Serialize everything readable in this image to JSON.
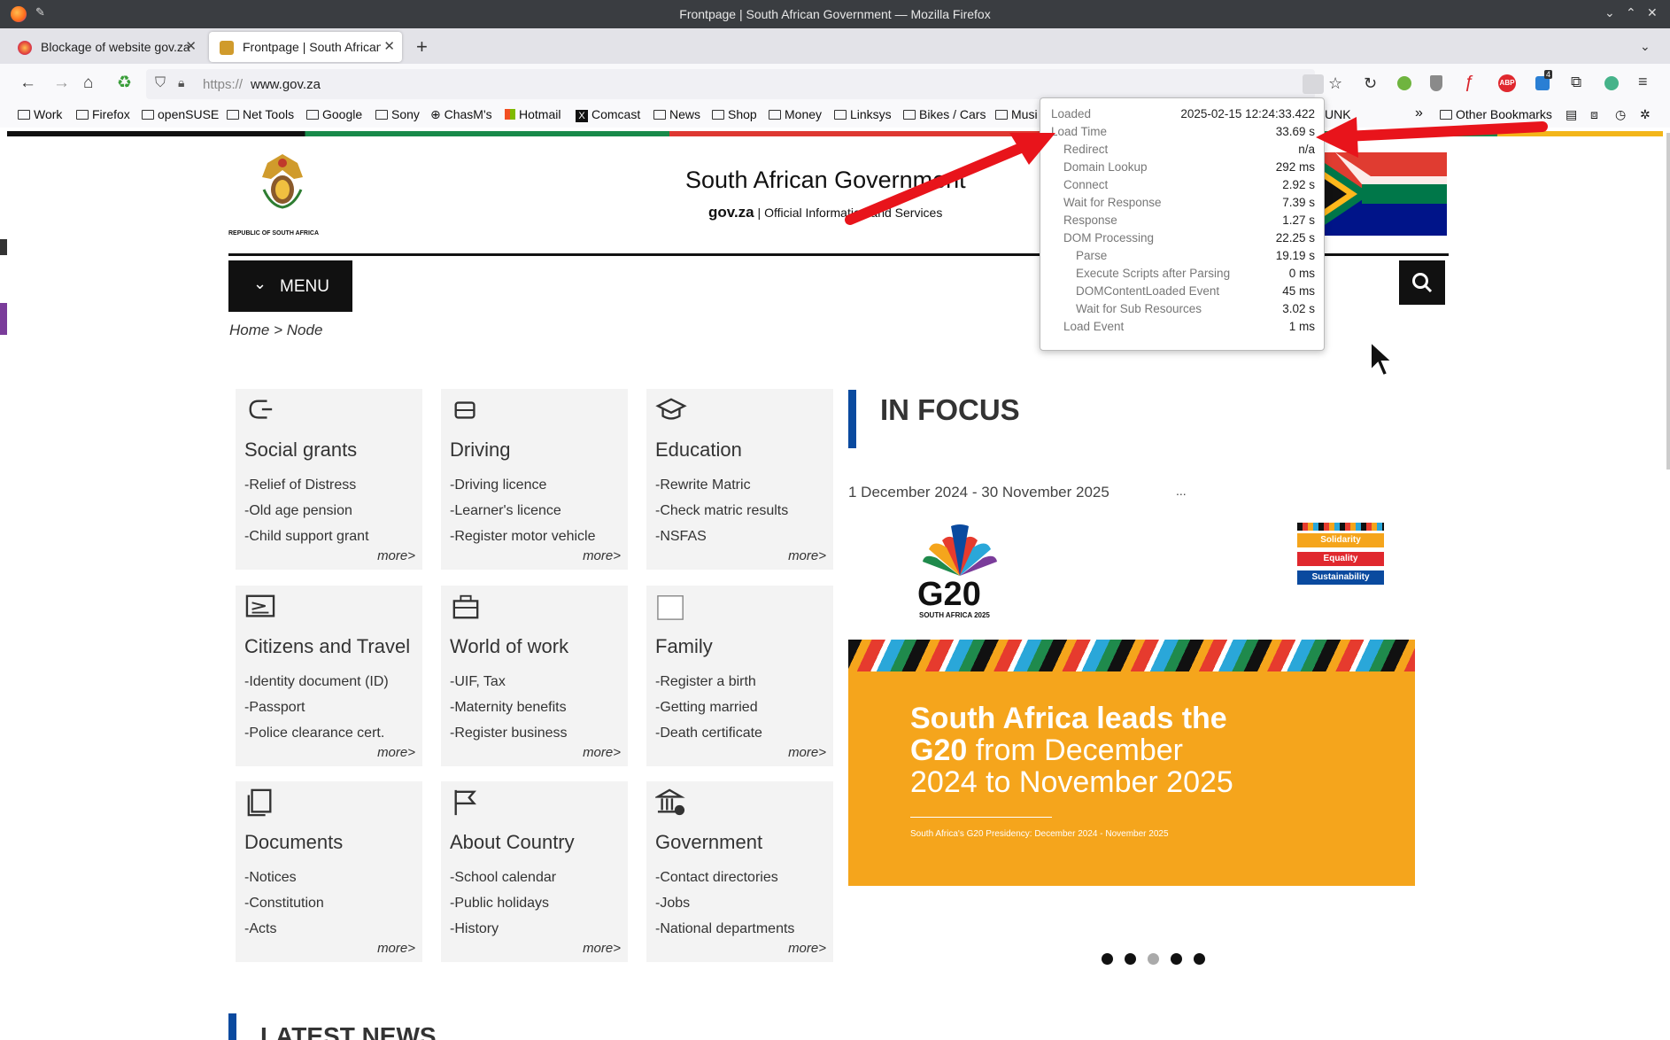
{
  "window": {
    "title": "Frontpage | South African Government — Mozilla Firefox",
    "controls": [
      "⌄",
      "⌃",
      "✕"
    ]
  },
  "tabs": [
    {
      "label": "Blockage of website gov.za",
      "active": false
    },
    {
      "label": "Frontpage | South African",
      "active": true
    }
  ],
  "new_tab_label": "+",
  "url": {
    "scheme": "https://",
    "host": "www.gov.za"
  },
  "bookmarks": [
    "Work",
    "Firefox",
    "openSUSE",
    "Net Tools",
    "Google",
    "Sony",
    "ChasM's",
    "Hotmail",
    "Comcast",
    "News",
    "Shop",
    "Money",
    "Linksys",
    "Bikes / Cars",
    "Musi"
  ],
  "bookmarks_tail": {
    "partial": "UNK",
    "overflow": "»",
    "other": "Other Bookmarks"
  },
  "toolbar_badge": "4",
  "site": {
    "coat_caption": "REPUBLIC OF SOUTH AFRICA",
    "title": "South African Government",
    "sub_brand": "gov.za",
    "sub_sep": "|",
    "sub_text": "Official Information and Services",
    "menu_label": "MENU",
    "breadcrumb": {
      "home": "Home",
      "sep": ">",
      "current": "Node"
    },
    "in_focus": "IN FOCUS",
    "focus_date": "1 December 2024 - 30 November 2025",
    "focus_ellipsis": "...",
    "g20_logo_text": "G20",
    "g20_logo_sub": "SOUTH AFRICA 2025",
    "values": [
      "Solidarity",
      "Equality",
      "Sustainability"
    ],
    "banner_line1": "South Africa leads the",
    "banner_line2_bold": "G20",
    "banner_line2": " from December",
    "banner_line3": "2024 to November 2025",
    "banner_caption": "South Africa's G20 Presidency: December 2024 - November 2025",
    "latest_news": "LATEST NEWS"
  },
  "cards": [
    {
      "title": "Social grants",
      "icon": "hand-coin-icon",
      "links": [
        "-Relief of Distress",
        "-Old age pension",
        "-Child support grant"
      ],
      "more": "more>"
    },
    {
      "title": "Driving",
      "icon": "car-icon",
      "links": [
        "-Driving licence",
        "-Learner's licence",
        "-Register motor vehicle"
      ],
      "more": "more>"
    },
    {
      "title": "Education",
      "icon": "graduation-cap-icon",
      "links": [
        "-Rewrite Matric",
        "-Check matric results",
        "-NSFAS"
      ],
      "more": "more>"
    },
    {
      "title": "Citizens and Travel",
      "icon": "plane-ticket-icon",
      "links": [
        "-Identity document (ID)",
        "-Passport",
        "-Police clearance cert."
      ],
      "more": "more>"
    },
    {
      "title": "World of work",
      "icon": "briefcase-icon",
      "links": [
        "-UIF, Tax",
        "-Maternity benefits",
        "-Register business"
      ],
      "more": "more>"
    },
    {
      "title": "Family",
      "icon": "family-icon",
      "links": [
        "-Register a birth",
        "-Getting married",
        "-Death certificate"
      ],
      "more": "more>"
    },
    {
      "title": "Documents",
      "icon": "documents-icon",
      "links": [
        "-Notices",
        "-Constitution",
        "-Acts"
      ],
      "more": "more>"
    },
    {
      "title": "About Country",
      "icon": "flag-icon",
      "links": [
        "-School calendar",
        "-Public holidays",
        "-History"
      ],
      "more": "more>"
    },
    {
      "title": "Government",
      "icon": "government-building-icon",
      "links": [
        "-Contact directories",
        "-Jobs",
        "-National departments"
      ],
      "more": "more>"
    }
  ],
  "carousel": {
    "count": 5,
    "active_index": 2
  },
  "perf": [
    {
      "label": "Loaded",
      "value": "2025-02-15 12:24:33.422",
      "indent": 0
    },
    {
      "label": "Load Time",
      "value": "33.69 s",
      "indent": 0
    },
    {
      "label": "Redirect",
      "value": "n/a",
      "indent": 1
    },
    {
      "label": "Domain Lookup",
      "value": "292 ms",
      "indent": 1
    },
    {
      "label": "Connect",
      "value": "2.92 s",
      "indent": 1
    },
    {
      "label": "Wait for Response",
      "value": "7.39 s",
      "indent": 1
    },
    {
      "label": "Response",
      "value": "1.27 s",
      "indent": 1
    },
    {
      "label": "DOM Processing",
      "value": "22.25 s",
      "indent": 1
    },
    {
      "label": "Parse",
      "value": "19.19 s",
      "indent": 2
    },
    {
      "label": "Execute Scripts after Parsing",
      "value": "0 ms",
      "indent": 2
    },
    {
      "label": "DOMContentLoaded Event",
      "value": "45 ms",
      "indent": 2
    },
    {
      "label": "Wait for Sub Resources",
      "value": "3.02 s",
      "indent": 2
    },
    {
      "label": "Load Event",
      "value": "1 ms",
      "indent": 1
    }
  ],
  "colors": {
    "annotation_arrow": "#e8141b",
    "focus_bar": "#0a4a9f",
    "banner_orange": "#f5a51c"
  }
}
